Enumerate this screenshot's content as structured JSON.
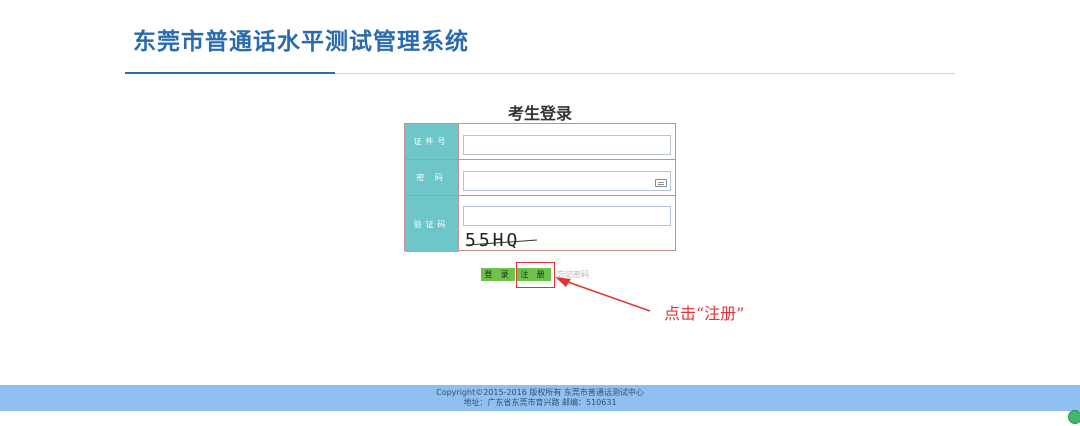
{
  "header": {
    "title": "东莞市普通话水平测试管理系统"
  },
  "login": {
    "title": "考生登录",
    "fields": {
      "id_label": "证件号",
      "id_value": "",
      "password_label": "密 码",
      "password_value": "",
      "captcha_label": "验证码",
      "captcha_value": "",
      "captcha_image_text": "55HQ"
    },
    "buttons": {
      "login": "登 录",
      "register": "注 册",
      "forgot": "忘记密码"
    }
  },
  "annotation": {
    "text": "点击“注册”",
    "color": "#e23434"
  },
  "footer": {
    "copyright": "Copyright©2015-2016 版权所有 东莞市普通话测试中心",
    "address": "地址：广东省东莞市育兴路 邮编：510631"
  },
  "colors": {
    "brand": "#2a6bb0",
    "label_bg": "#6fc6c8",
    "button": "#6cc24a",
    "footer_bg": "#8fc0f1"
  }
}
